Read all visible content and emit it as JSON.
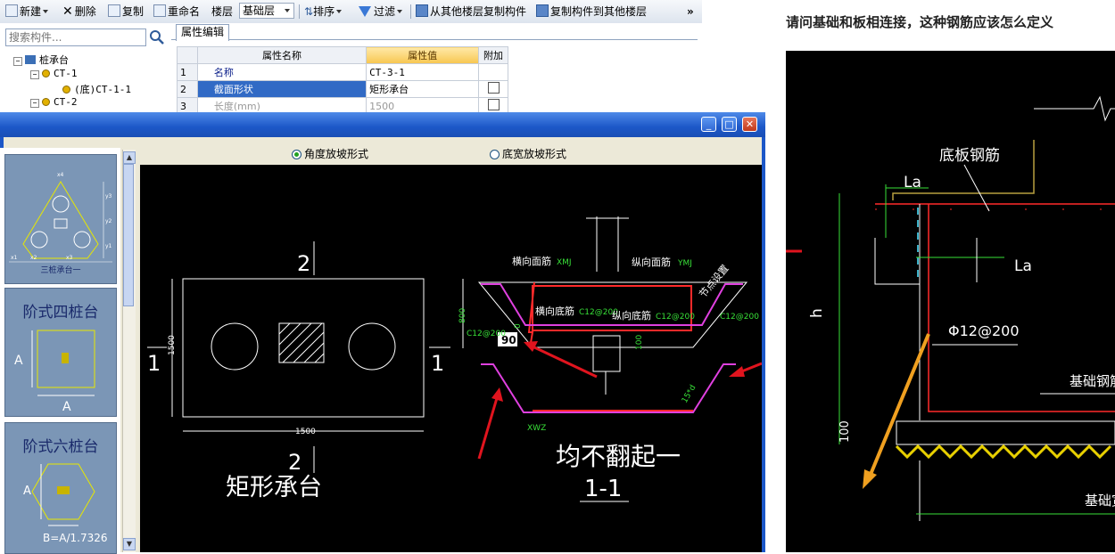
{
  "toolbar": {
    "new_label": "新建",
    "delete_label": "删除",
    "copy_label": "复制",
    "rename_label": "重命名",
    "floor_label": "楼层",
    "floor_value": "基础层",
    "sort_label": "排序",
    "filter_label": "过滤",
    "copy_from_floor_label": "从其他楼层复制构件",
    "copy_to_floor_label": "复制构件到其他楼层",
    "more_label": "»"
  },
  "search": {
    "placeholder": "搜索构件..."
  },
  "tree": {
    "root": "桩承台",
    "items": [
      {
        "label": "CT-1"
      },
      {
        "label": "(底)CT-1-1"
      },
      {
        "label": "CT-2"
      }
    ]
  },
  "properties": {
    "tab": "属性编辑",
    "headers": {
      "name": "属性名称",
      "value": "属性值",
      "extra": "附加"
    },
    "rows": [
      {
        "no": "1",
        "name": "名称",
        "value": "CT-3-1"
      },
      {
        "no": "2",
        "name": "截面形状",
        "value": "矩形承台"
      },
      {
        "no": "3",
        "name": "长度(mm)",
        "value": "1500"
      }
    ]
  },
  "dialog": {
    "radio_angle": "角度放坡形式",
    "radio_width": "底宽放坡形式",
    "selected_radio": "angle"
  },
  "thumbs": [
    {
      "caption": "三桩承台一",
      "dims": [
        "x1",
        "x2",
        "x3",
        "x4",
        "y1",
        "y2",
        "y3"
      ]
    },
    {
      "caption": "阶式四桩台",
      "dims": [
        "A",
        "A"
      ]
    },
    {
      "caption": "阶式六桩台",
      "dims": [
        "A",
        "B=A/1.7326"
      ]
    }
  ],
  "cad": {
    "plan_title": "矩形承台",
    "plan_dim_x": "1500",
    "plan_dim_y": "1500",
    "section_mark_1": "1",
    "section_mark_2": "2",
    "section_title": "1-1",
    "note": "均不翻起一",
    "labels": {
      "top_x": "横向面筋",
      "top_x_code": "XMJ",
      "top_y": "纵向面筋",
      "top_y_code": "YMJ",
      "bot_x": "横向底筋",
      "bot_y": "纵向底筋",
      "rebar": "C12@200",
      "node": "节点设置",
      "angle": "90",
      "height": "800",
      "cover": "100",
      "zero": "0",
      "anchor": "15*d",
      "xwz": "XWZ"
    }
  },
  "article": {
    "question": "请问基础和板相连接，这种钢筋应该怎么定义",
    "labels": {
      "bottom_slab_rebar": "底板钢筋",
      "la1": "La",
      "la2": "La",
      "h": "h",
      "rebar": "Φ12@200",
      "foundation_rebar": "基础钢筋",
      "dim100": "100",
      "foundation_width": "基础宽"
    }
  },
  "colors": {
    "cad_bg": "#000000",
    "rebar_red": "#ff2a2a",
    "rebar_magenta": "#e040e0",
    "cad_green": "#38e038",
    "annot_arrow": "#e0141e",
    "window_blue": "#1c57c8"
  }
}
